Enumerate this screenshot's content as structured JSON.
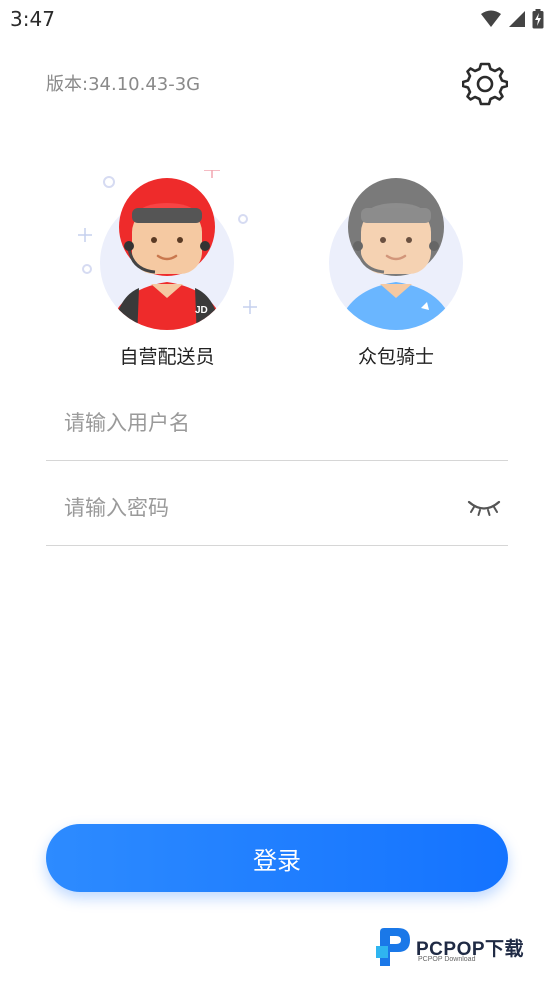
{
  "status_bar": {
    "time": "3:47"
  },
  "header": {
    "version": "版本:34.10.43-3G",
    "settings_icon": "gear-icon"
  },
  "roles": [
    {
      "label": "自营配送员",
      "selected": true,
      "badge": "JD"
    },
    {
      "label": "众包骑士",
      "selected": false
    }
  ],
  "form": {
    "username_placeholder": "请输入用户名",
    "username_value": "",
    "password_placeholder": "请输入密码",
    "password_value": "",
    "password_toggle_icon": "eye-closed-icon"
  },
  "login_button": {
    "label": "登录"
  },
  "watermark": {
    "title": "PCPOP下载",
    "subtitle": "PCPOP Download"
  },
  "colors": {
    "accent": "#1473ff",
    "selected_helmet": "#ee2b2b",
    "unselected_helmet": "#7a7a7a",
    "unselected_shirt": "#6ab6ff"
  }
}
